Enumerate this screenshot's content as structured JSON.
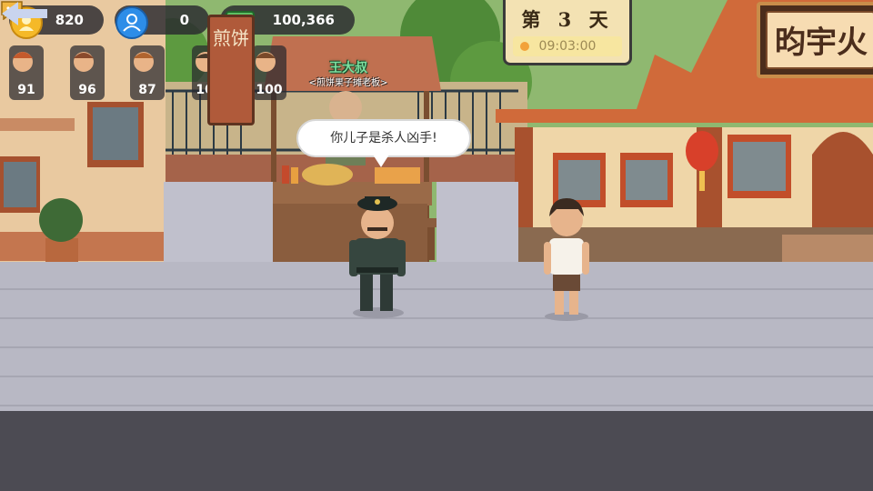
{
  "hud": {
    "coins": "820",
    "followers": "0",
    "cash": "100,366"
  },
  "npc_status": [
    {
      "id": "npc-1",
      "value": "91"
    },
    {
      "id": "npc-2",
      "value": "96"
    },
    {
      "id": "npc-3",
      "value": "87"
    },
    {
      "id": "npc-4",
      "value": "100"
    },
    {
      "id": "npc-5",
      "value": "100"
    }
  ],
  "day_panel": {
    "day_label": "第 3 天",
    "time": "09:03:00"
  },
  "shop_sign": "昀宇火",
  "stall_sign": "煎饼",
  "stall_owner": {
    "name": "王大叔",
    "title": "<煎饼果子摊老板>"
  },
  "dialogue": "你儿子是杀人凶手!",
  "icons": {
    "coin": "coin-icon",
    "user": "user-icon",
    "cash": "cash-stack-icon",
    "back": "back-arrow-icon",
    "chat": "chat-bubble-icon",
    "clock": "sun-dot-icon"
  },
  "colors": {
    "hud_bg": "#28282e",
    "coin": "#f5b928",
    "user": "#2d8de8",
    "cash": "#3fa44a",
    "day_panel": "#f3e2b3",
    "name_green": "#7ee0a0"
  }
}
